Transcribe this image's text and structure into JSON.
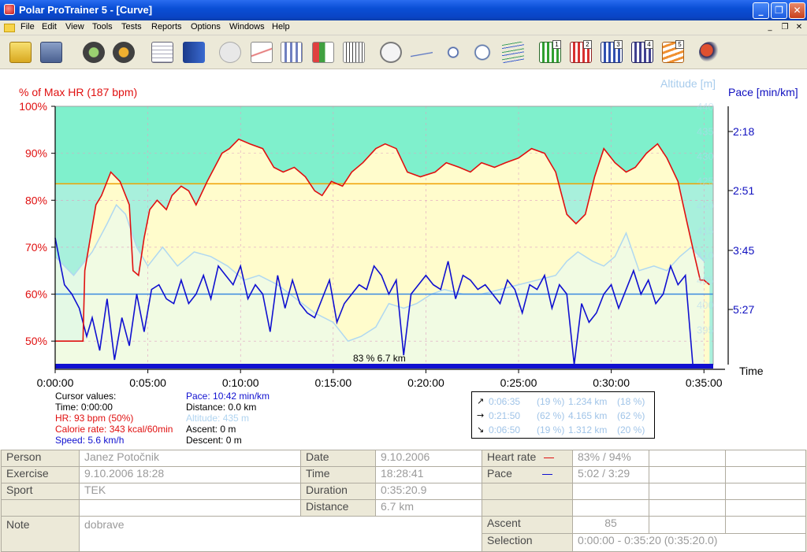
{
  "window": {
    "title": "Polar ProTrainer 5 - [Curve]",
    "minimize": "_",
    "restore": "❐",
    "close": "✕",
    "mdi_minimize": "_",
    "mdi_restore": "❐",
    "mdi_close": "✕"
  },
  "menu": [
    "File",
    "Edit",
    "View",
    "Tools",
    "Tests",
    "Reports",
    "Options",
    "Windows",
    "Help"
  ],
  "toolbar": {
    "buttons": [
      "open-folder-icon",
      "save-disk-icon",
      "sync-icon",
      "settings-sync-icon",
      "calendar-icon",
      "book-icon",
      "messages-icon",
      "curve-icon",
      "column-icon",
      "zones-percent-icon",
      "table-icon",
      "zoom-1-1-icon",
      "info-curve-icon",
      "info-marker-icon",
      "time-speed-icon",
      "multi-curve-icon",
      "exercise-1-icon",
      "exercise-2-icon",
      "exercise-3-icon",
      "exercise-4-icon",
      "exercise-5-icon",
      "users-icon"
    ],
    "exercise_numbers": [
      "1",
      "2",
      "3",
      "4",
      "5"
    ]
  },
  "chart_data": {
    "type": "line",
    "title": "",
    "left_axis_label": "% of Max HR (187 bpm)",
    "right_axis_label_altitude": "Altitude [m]",
    "right_axis_label_pace": "Pace [min/km]",
    "x_axis_label": "Time",
    "x_ticks": [
      "0:00:00",
      "0:05:00",
      "0:10:00",
      "0:15:00",
      "0:20:00",
      "0:25:00",
      "0:30:00",
      "0:35:00"
    ],
    "hr_ticks": [
      "100%",
      "90%",
      "80%",
      "70%",
      "60%",
      "50%"
    ],
    "pace_ticks": [
      "2:18",
      "2:51",
      "3:45",
      "5:27"
    ],
    "altitude_ticks": [
      "440",
      "435",
      "430",
      "425",
      "420",
      "415",
      "410",
      "405",
      "400",
      "395"
    ],
    "xlim_min": [
      0,
      35.5
    ],
    "hr_ylim": [
      45,
      100
    ],
    "colors": {
      "upper_zone": "#7ff0cc",
      "lower_zone": "#a8f0dc",
      "hr_fill": "#fffccc",
      "alt_fill": "#eefae6",
      "hr_line": "#e01010",
      "pace_line": "#1010d0",
      "altitude_line": "#b0d8f0",
      "target_line": "#f0a000",
      "avg_pace_line": "#3a8ae0"
    },
    "target_hr_percent": 83.5,
    "avg_pace_line_percent": 60,
    "inline_label": "83 % 6.7 km",
    "series": [
      {
        "name": "HR",
        "x": [
          0,
          1.5,
          1.6,
          2.2,
          2.5,
          3.0,
          3.5,
          4.0,
          4.2,
          4.5,
          4.8,
          5.1,
          5.5,
          6.0,
          6.3,
          6.8,
          7.2,
          7.6,
          8.2,
          8.6,
          9.0,
          9.4,
          9.9,
          10.5,
          11.2,
          11.8,
          12.3,
          12.9,
          13.5,
          14.0,
          14.4,
          14.9,
          15.5,
          16.0,
          16.6,
          17.3,
          17.8,
          18.4,
          19.0,
          19.7,
          20.5,
          21.1,
          21.8,
          22.4,
          23.0,
          23.7,
          24.3,
          25.0,
          25.7,
          26.4,
          27.0,
          27.6,
          28.1,
          28.6,
          29.1,
          29.6,
          30.2,
          30.8,
          31.3,
          31.9,
          32.5,
          33.0,
          33.6,
          34.1,
          34.5,
          34.8,
          35.0,
          35.3
        ],
        "values": [
          50,
          50,
          65,
          79,
          81,
          86,
          84,
          79,
          65,
          64,
          72,
          78,
          80,
          78,
          81,
          83,
          82,
          79,
          84,
          87,
          90,
          91,
          93,
          92,
          91,
          87,
          86,
          87,
          85,
          82,
          81,
          84,
          83,
          86,
          88,
          91,
          92,
          91,
          86,
          85,
          86,
          88,
          87,
          86,
          88,
          87,
          88,
          89,
          91,
          90,
          86,
          77,
          75,
          77,
          85,
          91,
          88,
          86,
          87,
          90,
          92,
          89,
          84,
          75,
          68,
          63,
          63,
          62
        ]
      },
      {
        "name": "Pace",
        "x": [
          0,
          0.5,
          0.9,
          1.3,
          1.7,
          2.0,
          2.4,
          2.8,
          3.2,
          3.6,
          4.0,
          4.4,
          4.8,
          5.2,
          5.6,
          6.0,
          6.4,
          6.8,
          7.2,
          7.6,
          8.0,
          8.4,
          8.8,
          9.2,
          9.6,
          10.0,
          10.4,
          10.8,
          11.2,
          11.6,
          12.0,
          12.4,
          12.8,
          13.2,
          13.6,
          14.0,
          14.4,
          14.8,
          15.2,
          15.6,
          16.0,
          16.4,
          16.8,
          17.2,
          17.6,
          18.0,
          18.4,
          18.8,
          19.2,
          19.6,
          20.0,
          20.4,
          20.8,
          21.2,
          21.6,
          22.0,
          22.4,
          22.8,
          23.2,
          23.6,
          24.0,
          24.4,
          24.8,
          25.2,
          25.6,
          26.0,
          26.4,
          26.8,
          27.2,
          27.6,
          28.0,
          28.4,
          28.8,
          29.2,
          29.6,
          30.0,
          30.4,
          30.8,
          31.2,
          31.6,
          32.0,
          32.4,
          32.8,
          33.2,
          33.6,
          34.0,
          34.4,
          34.8,
          35.2
        ],
        "values": [
          72,
          62,
          60,
          57,
          51,
          55,
          48,
          59,
          46,
          55,
          49,
          60,
          52,
          61,
          62,
          59,
          58,
          63,
          58,
          60,
          64,
          59,
          66,
          64,
          62,
          66,
          59,
          62,
          60,
          52,
          64,
          57,
          63,
          58,
          56,
          55,
          59,
          63,
          54,
          58,
          60,
          62,
          61,
          66,
          64,
          60,
          63,
          47,
          60,
          62,
          64,
          62,
          61,
          67,
          59,
          64,
          63,
          61,
          62,
          60,
          58,
          63,
          61,
          56,
          62,
          61,
          64,
          57,
          62,
          60,
          45,
          58,
          54,
          56,
          60,
          62,
          57,
          61,
          65,
          60,
          63,
          58,
          60,
          66,
          62,
          64,
          45,
          45,
          45
        ]
      },
      {
        "name": "Altitude",
        "x": [
          0,
          1.0,
          2.0,
          2.8,
          3.3,
          3.8,
          4.4,
          5.0,
          5.8,
          6.6,
          7.5,
          8.4,
          9.3,
          10.2,
          11.0,
          12.0,
          13.0,
          14.0,
          15.0,
          15.8,
          16.5,
          17.3,
          18.0,
          18.8,
          19.5,
          20.3,
          21.0,
          22.0,
          23.0,
          24.0,
          25.0,
          26.0,
          27.0,
          27.6,
          28.2,
          29.0,
          29.6,
          30.2,
          30.8,
          31.5,
          32.3,
          33.0,
          33.7,
          34.3,
          35.0
        ],
        "values": [
          68,
          64,
          69,
          75,
          79,
          77,
          70,
          66,
          70,
          66,
          69,
          68,
          66,
          63,
          64,
          62,
          59,
          56,
          54,
          50,
          51,
          53,
          58,
          57,
          58,
          60,
          61,
          60,
          60,
          61,
          62,
          63,
          64,
          67,
          69,
          67,
          66,
          68,
          73,
          65,
          66,
          65,
          68,
          70,
          67
        ]
      }
    ]
  },
  "cursor": {
    "title": "Cursor values:",
    "time": "Time: 0:00:00",
    "hr": "HR: 93 bpm (50%)",
    "calorie": "Calorie rate: 343 kcal/60min",
    "speed": "Speed: 5.6 km/h",
    "pace": "Pace: 10:42 min/km",
    "distance": "Distance: 0.0 km",
    "altitude": "Altitude: 435 m",
    "ascent": "Ascent: 0 m",
    "descent": "Descent: 0 m"
  },
  "zones": [
    {
      "arrow": "↗",
      "time": "0:06:35",
      "time_pct": "(19 %)",
      "dist": "1.234 km",
      "dist_pct": "(18 %)"
    },
    {
      "arrow": "→",
      "time": "0:21:50",
      "time_pct": "(62 %)",
      "dist": "4.165 km",
      "dist_pct": "(62 %)"
    },
    {
      "arrow": "↘",
      "time": "0:06:50",
      "time_pct": "(19 %)",
      "dist": "1.312 km",
      "dist_pct": "(20 %)"
    }
  ],
  "info": {
    "person_label": "Person",
    "person": "Janez Potočnik",
    "exercise_label": "Exercise",
    "exercise": "9.10.2006 18:28",
    "sport_label": "Sport",
    "sport": "TEK",
    "note_label": "Note",
    "note": "dobrave",
    "date_label": "Date",
    "date": "9.10.2006",
    "time_label": "Time",
    "time": "18:28:41",
    "duration_label": "Duration",
    "duration": "0:35:20.9",
    "distance_label": "Distance",
    "distance": "6.7 km",
    "heart_rate_label": "Heart rate",
    "heart_rate": "83% / 94%",
    "pace_label": "Pace",
    "pace": "5:02 / 3:29",
    "ascent_label": "Ascent",
    "ascent": "85",
    "selection_label": "Selection",
    "selection": "0:00:00 - 0:35:20 (0:35:20.0)"
  }
}
